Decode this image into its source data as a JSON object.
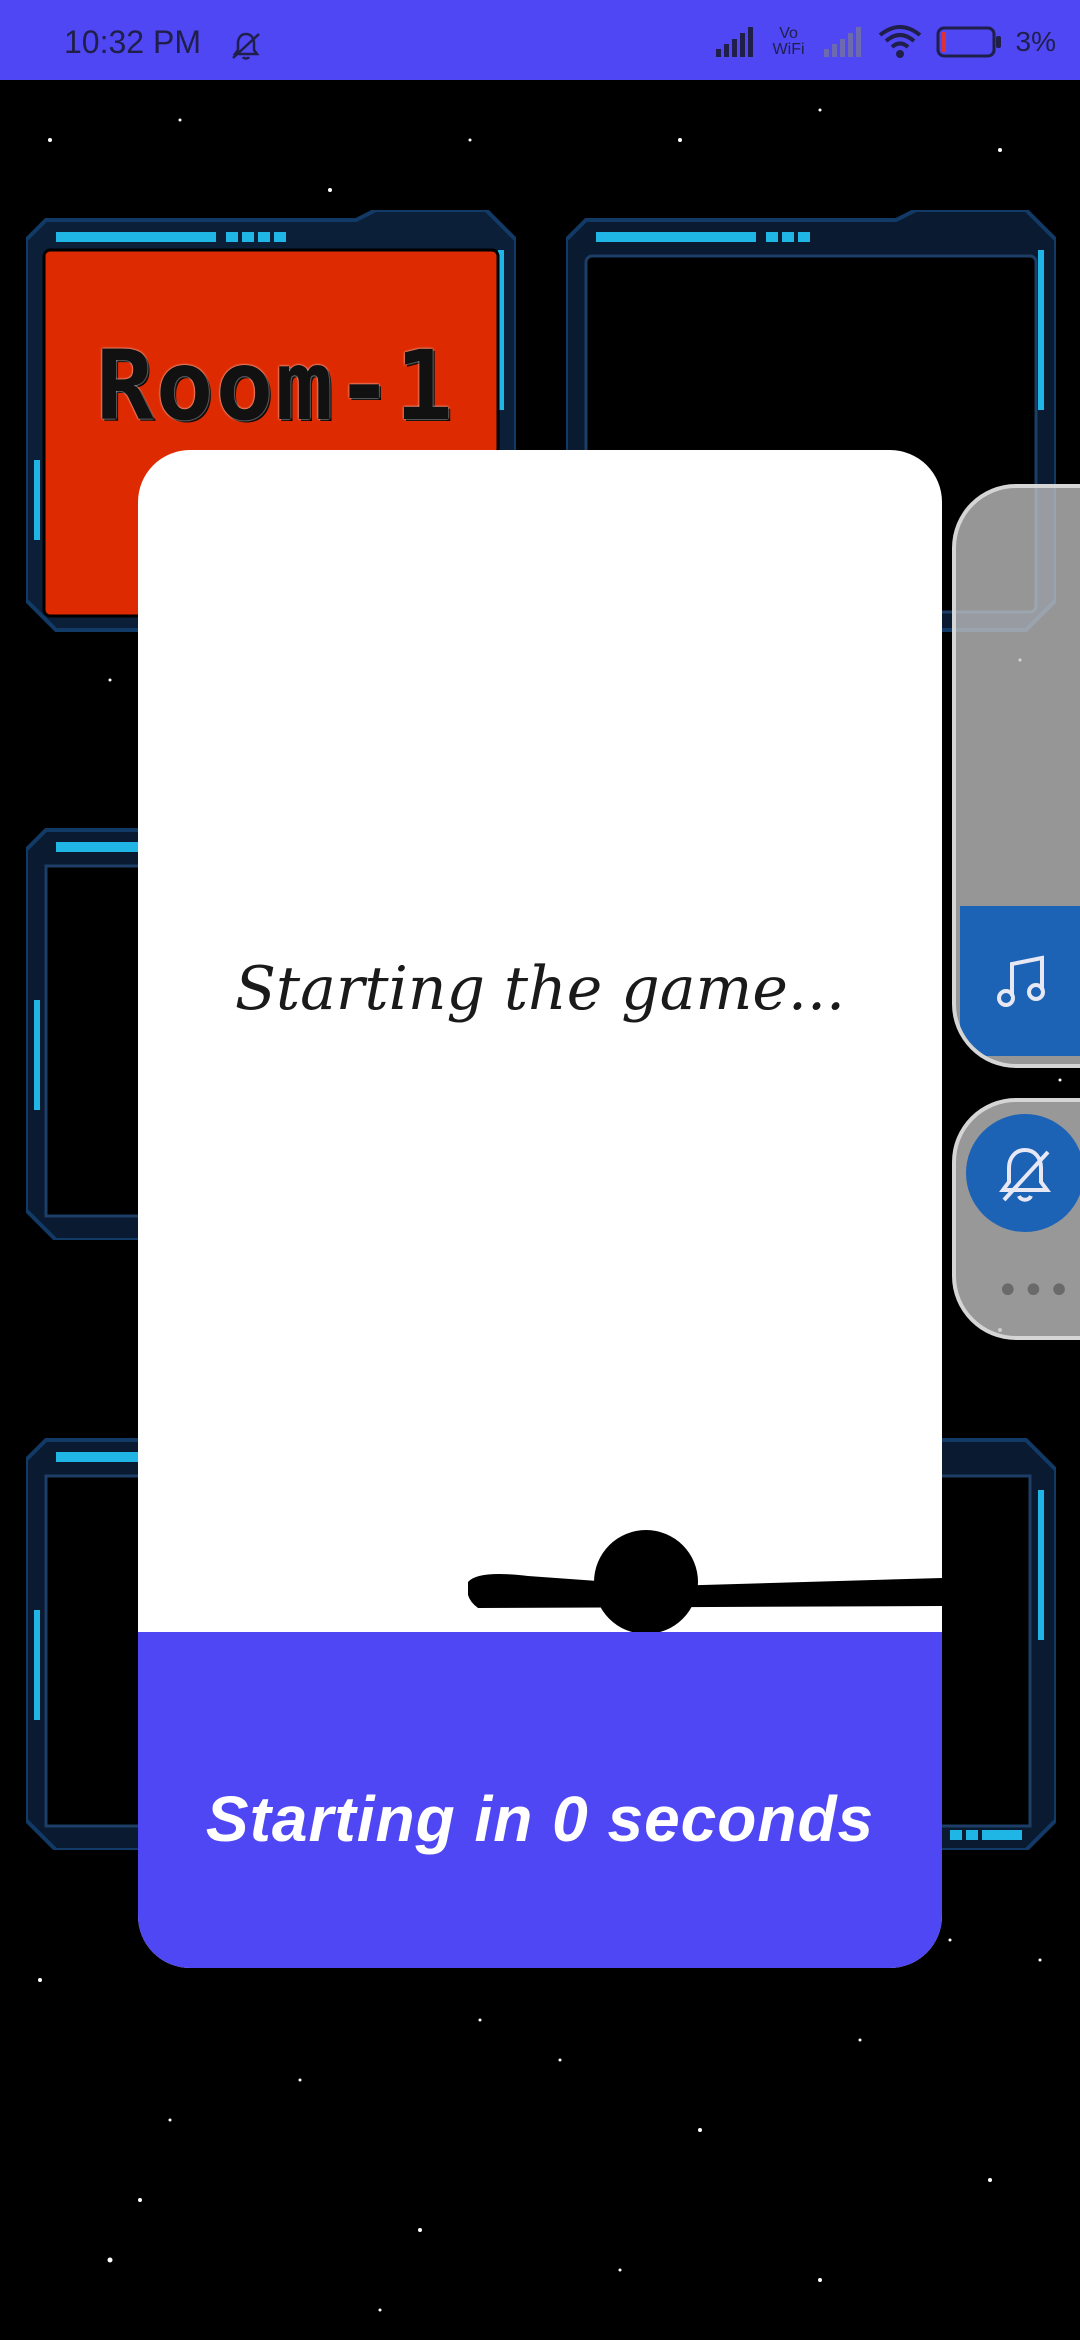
{
  "status_bar": {
    "time": "10:32 PM",
    "network_label": "Vo WiFi",
    "battery_percent": "3%",
    "icons": [
      "bell-off-icon",
      "signal-icon",
      "vowifi-icon",
      "signal-weak-icon",
      "wifi-icon",
      "battery-icon"
    ]
  },
  "rooms": [
    {
      "label": "Room-1",
      "color": "#dd2a00"
    }
  ],
  "dialog": {
    "message": "Starting the game...",
    "countdown": "Starting in 0 seconds"
  },
  "floating_controls": {
    "icons": [
      "music-note-icon",
      "bell-off-icon",
      "more-icon"
    ]
  },
  "colors": {
    "accent": "#4f47f3",
    "frame_cyan": "#1fb6e6",
    "frame_dark": "#0e2a4a",
    "floating_blue": "#1c63b6"
  }
}
